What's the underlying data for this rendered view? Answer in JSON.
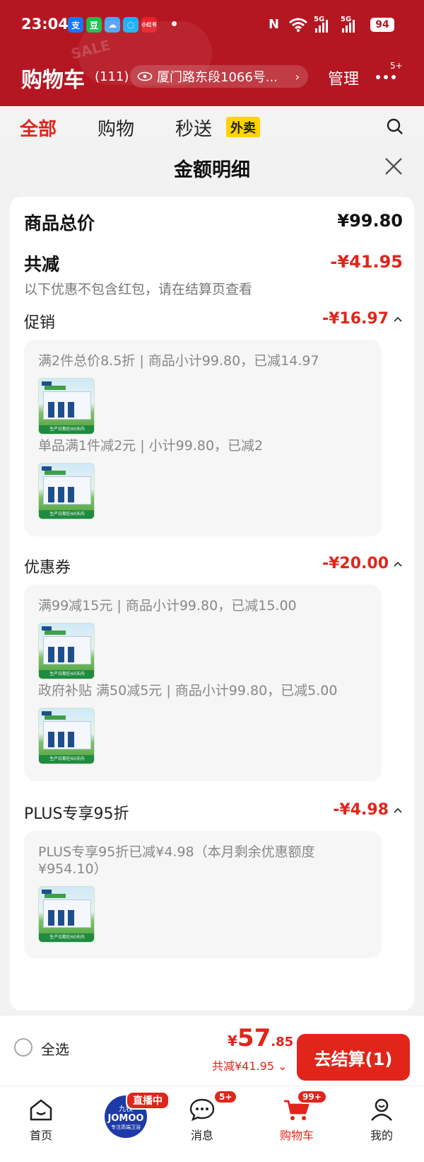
{
  "status": {
    "time": "23:04",
    "apps": [
      {
        "name": "alipay-icon",
        "glyph": "支",
        "color": "#1677ff"
      },
      {
        "name": "douban-icon",
        "glyph": "豆",
        "color": "#1ebd4c"
      },
      {
        "name": "weather-icon",
        "glyph": "☁",
        "color": "#4fa3f7"
      },
      {
        "name": "chat-icon",
        "glyph": "◌",
        "color": "#18b0f5"
      },
      {
        "name": "xiaohongshu-icon",
        "glyph": "小红书",
        "color": "#e5222a"
      }
    ],
    "nfc": "N",
    "signal1": "5G",
    "signal2": "5G",
    "battery": "94"
  },
  "header": {
    "deco": "SALE",
    "title": "购物车",
    "count": "(111)",
    "address": "厦门路东段1066号...",
    "manage": "管理",
    "more_badge": "5+"
  },
  "tabs": [
    {
      "label": "全部",
      "active": true
    },
    {
      "label": "购物",
      "active": false
    },
    {
      "label": "秒送",
      "active": false
    }
  ],
  "tag_waimai": "外卖",
  "sheet": {
    "title": "金额明细",
    "total_label": "商品总价",
    "total_value": "¥99.80",
    "reduce_label": "共减",
    "reduce_value": "-¥41.95",
    "note": "以下优惠不包含红包，请在结算页查看",
    "sections": [
      {
        "label": "促销",
        "value": "-¥16.97",
        "items": [
          "满2件总价8.5折 | 商品小计99.80，已减14.97",
          "单品满1件减2元 | 小计99.80，已减2"
        ]
      },
      {
        "label": "优惠券",
        "value": "-¥20.00",
        "items": [
          "满99减15元 | 商品小计99.80，已减15.00",
          "政府补贴 满50减5元 | 商品小计99.80，已减5.00"
        ]
      },
      {
        "label": "PLUS专享95折",
        "value": "-¥4.98",
        "items": [
          "PLUS专享95折已减¥4.98（本月剩余优惠额度¥954.10）"
        ]
      }
    ],
    "thumb_caption": "生产日期在60天内"
  },
  "actionbar": {
    "select_all": "全选",
    "price_symbol": "¥",
    "price_int": "57",
    "price_dec": ".85",
    "discount": "共减¥41.95 ⌄",
    "checkout": "去结算(1)"
  },
  "tabbar": {
    "home": "首页",
    "live_line1": "九牧",
    "live_line2": "JOMOO",
    "live_line3": "专注高端卫浴",
    "live_badge": "直播中",
    "message": "消息",
    "message_badge": "5+",
    "cart": "购物车",
    "cart_badge": "99+",
    "mine": "我的"
  },
  "colors": {
    "brand_red": "#e1251b",
    "header_red": "#b51722"
  }
}
